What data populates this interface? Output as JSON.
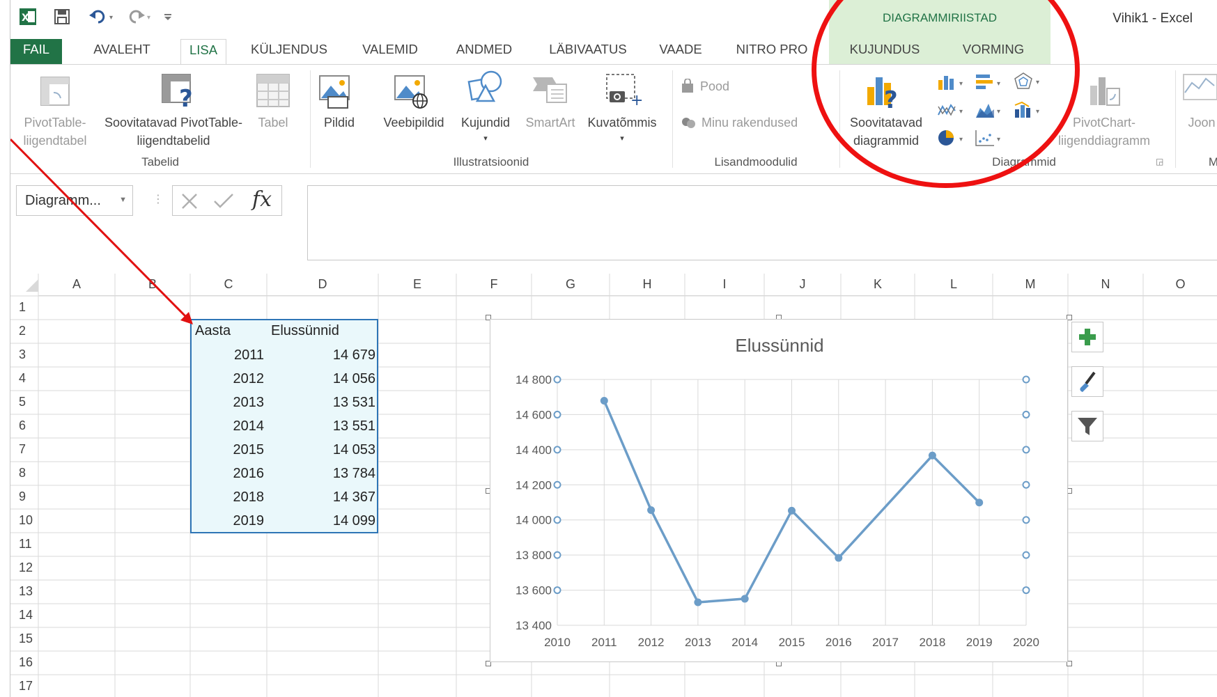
{
  "window": {
    "title": "Vihik1 - Excel"
  },
  "context_group": {
    "title": "DIAGRAMMIRIISTAD",
    "color": "#dcefd6",
    "text_color": "#217346"
  },
  "quick_access": [
    {
      "icon": "excel-logo-icon"
    },
    {
      "icon": "save-icon"
    },
    {
      "icon": "undo-icon"
    },
    {
      "icon": "redo-icon"
    },
    {
      "icon": "customize-qat-icon"
    }
  ],
  "tabs": [
    "FAIL",
    "AVALEHT",
    "LISA",
    "KÜLJENDUS",
    "VALEMID",
    "ANDMED",
    "LÄBIVAATUS",
    "VAADE",
    "NITRO PRO",
    "KUJUNDUS",
    "VORMING"
  ],
  "active_tab": "LISA",
  "ribbon": {
    "groups": {
      "tables": "Tabelid",
      "illustrations": "Illustratsioonid",
      "addins": "Lisandmoodulid",
      "charts": "Diagrammid",
      "m": "M"
    },
    "buttons": {
      "pivot_line1": "PivotTable-",
      "pivot_line2": "liigendtabel",
      "rec_pivot_line1": "Soovitatavad PivotTable-",
      "rec_pivot_line2": "liigendtabelid",
      "table": "Tabel",
      "pictures": "Pildid",
      "online_pictures": "Veebipildid",
      "shapes": "Kujundid",
      "smartart": "SmartArt",
      "screenshot": "Kuvatõmmis",
      "store": "Pood",
      "my_apps": "Minu rakendused",
      "rec_charts_line1": "Soovitatavad",
      "rec_charts_line2": "diagrammid",
      "pivotchart_line1": "PivotChart-",
      "pivotchart_line2": "liigenddiagramm",
      "line": "Joon"
    }
  },
  "formula_bar": {
    "name_box": "Diagramm...",
    "fx": "fx",
    "formula": ""
  },
  "columns": [
    "A",
    "B",
    "C",
    "D",
    "E",
    "F",
    "G",
    "H",
    "I",
    "J",
    "K",
    "L",
    "M",
    "N",
    "O"
  ],
  "rows": [
    "1",
    "2",
    "3",
    "4",
    "5",
    "6",
    "7",
    "8",
    "9",
    "10",
    "11",
    "12",
    "13",
    "14",
    "15",
    "16",
    "17"
  ],
  "table": {
    "headers": [
      "Aasta",
      "Elussünnid"
    ],
    "rows": [
      [
        "2011",
        "14 679"
      ],
      [
        "2012",
        "14 056"
      ],
      [
        "2013",
        "13 531"
      ],
      [
        "2014",
        "13 551"
      ],
      [
        "2015",
        "14 053"
      ],
      [
        "2016",
        "13 784"
      ],
      [
        "2018",
        "14 367"
      ],
      [
        "2019",
        "14 099"
      ]
    ]
  },
  "chart_data": {
    "type": "line",
    "title": "Elussünnid",
    "x": [
      2011,
      2012,
      2013,
      2014,
      2015,
      2016,
      2018,
      2019
    ],
    "series": [
      {
        "values": [
          14679,
          14056,
          13531,
          13551,
          14053,
          13784,
          14367,
          14099
        ],
        "color": "#6c9dc8"
      }
    ],
    "xlim": [
      2010,
      2020
    ],
    "ylim": [
      13400,
      14800
    ],
    "x_ticks": [
      "2010",
      "2011",
      "2012",
      "2013",
      "2014",
      "2015",
      "2016",
      "2017",
      "2018",
      "2019",
      "2020"
    ],
    "y_ticks": [
      "13 400",
      "13 600",
      "13 800",
      "14 000",
      "14 200",
      "14 400",
      "14 600",
      "14 800"
    ],
    "grid": true,
    "legend": "none"
  },
  "colors": {
    "excel_green": "#217346",
    "annotation_red": "#e11111",
    "selection_blue": "#2e75b6",
    "selection_fill": "#eaf8fb"
  }
}
